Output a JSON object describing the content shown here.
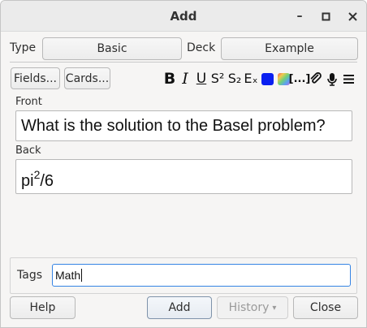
{
  "window": {
    "title": "Add",
    "minimize_glyph": "–",
    "maximize_glyph": "□",
    "close_glyph": "✕"
  },
  "top_row": {
    "type_label": "Type",
    "type_value": "Basic",
    "deck_label": "Deck",
    "deck_value": "Example"
  },
  "toolbar": {
    "fields_button": "Fields...",
    "cards_button": "Cards...",
    "bold": "B",
    "italic": "I",
    "underline": "U",
    "superscript": "S²",
    "subscript": "S₂",
    "clear_format": "Eₓ",
    "cloze": "[...]",
    "text_color": "#0a1ff0",
    "icons": [
      "bold-icon",
      "italic-icon",
      "underline-icon",
      "superscript-icon",
      "subscript-icon",
      "clear-formatting-icon",
      "text-color-icon",
      "highlight-color-icon",
      "cloze-icon",
      "attach-icon",
      "record-audio-icon",
      "more-icon"
    ]
  },
  "fields": {
    "front_label": "Front",
    "front_value": "What is the solution to the Basel problem?",
    "back_label": "Back",
    "back_base": "pi",
    "back_sup": "2",
    "back_rest": "/6"
  },
  "tags": {
    "label": "Tags",
    "value": "Math"
  },
  "buttons": {
    "help": "Help",
    "add": "Add",
    "history": "History",
    "history_arrow": "▾",
    "close": "Close"
  }
}
